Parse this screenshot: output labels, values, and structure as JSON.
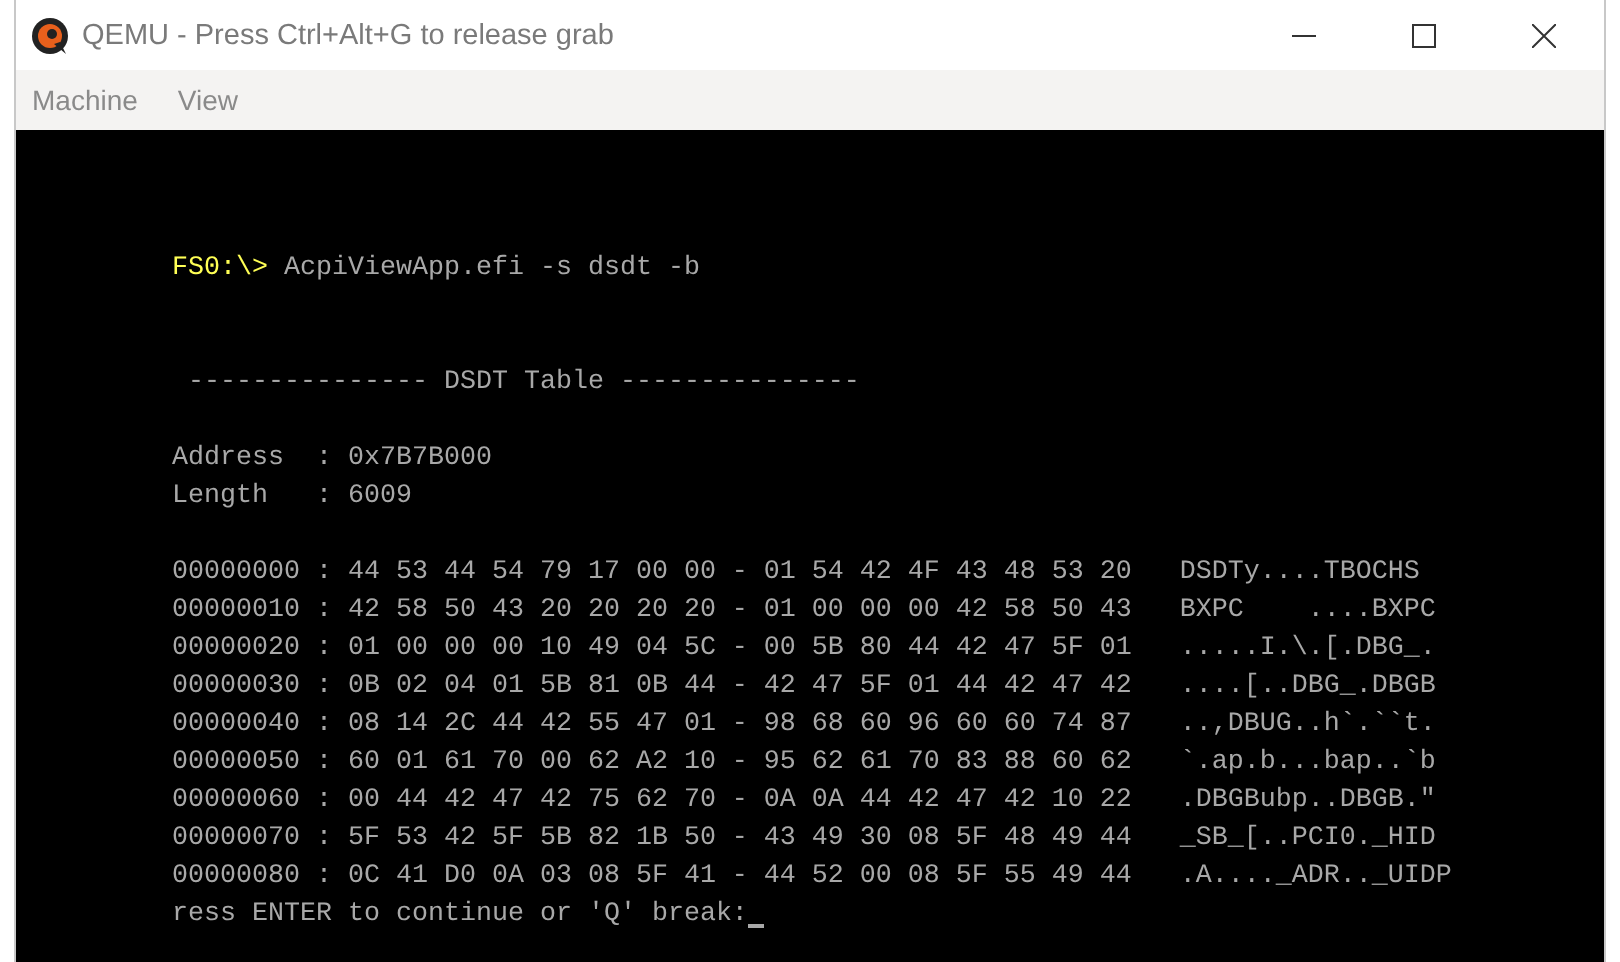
{
  "window": {
    "title": "QEMU - Press Ctrl+Alt+G to release grab"
  },
  "menu": [
    {
      "label": "Machine"
    },
    {
      "label": "View"
    }
  ],
  "console": {
    "lines": [
      {
        "kind": "command",
        "prompt": "FS0:\\>",
        "text": "AcpiViewApp.efi -s dsdt -b"
      },
      {
        "kind": "blank"
      },
      {
        "kind": "blank"
      },
      {
        "kind": "heading",
        "text": " --------------- DSDT Table ---------------"
      },
      {
        "kind": "blank"
      },
      {
        "kind": "field",
        "text": "Address  : 0x7B7B000"
      },
      {
        "kind": "field",
        "text": "Length   : 6009"
      },
      {
        "kind": "blank"
      },
      {
        "kind": "hex",
        "hex": "00000000 : 44 53 44 54 79 17 00 00 - 01 54 42 4F 43 48 53 20",
        "ascii": "DSDTy....TBOCHS"
      },
      {
        "kind": "hex",
        "hex": "00000010 : 42 58 50 43 20 20 20 20 - 01 00 00 00 42 58 50 43",
        "ascii": "BXPC    ....BXPC"
      },
      {
        "kind": "hex",
        "hex": "00000020 : 01 00 00 00 10 49 04 5C - 00 5B 80 44 42 47 5F 01",
        "ascii": ".....I.\\.[.DBG_."
      },
      {
        "kind": "hex",
        "hex": "00000030 : 0B 02 04 01 5B 81 0B 44 - 42 47 5F 01 44 42 47 42",
        "ascii": "....[..DBG_.DBGB"
      },
      {
        "kind": "hex",
        "hex": "00000040 : 08 14 2C 44 42 55 47 01 - 98 68 60 96 60 60 74 87",
        "ascii": "..,DBUG..h`.``t."
      },
      {
        "kind": "hex",
        "hex": "00000050 : 60 01 61 70 00 62 A2 10 - 95 62 61 70 83 88 60 62",
        "ascii": "`.ap.b...bap..`b"
      },
      {
        "kind": "hex",
        "hex": "00000060 : 00 44 42 47 42 75 62 70 - 0A 0A 44 42 47 42 10 22",
        "ascii": ".DBGBubp..DBGB.\""
      },
      {
        "kind": "hex",
        "hex": "00000070 : 5F 53 42 5F 5B 82 1B 50 - 43 49 30 08 5F 48 49 44",
        "ascii": "_SB_[..PCI0._HID"
      },
      {
        "kind": "hex",
        "hex": "00000080 : 0C 41 D0 0A 03 08 5F 41 - 44 52 00 08 5F 55 49 44",
        "ascii": ".A...._ADR.._UIDP"
      },
      {
        "kind": "prompt",
        "text": "ress ENTER to continue or 'Q' break:",
        "cursor": true
      }
    ]
  }
}
